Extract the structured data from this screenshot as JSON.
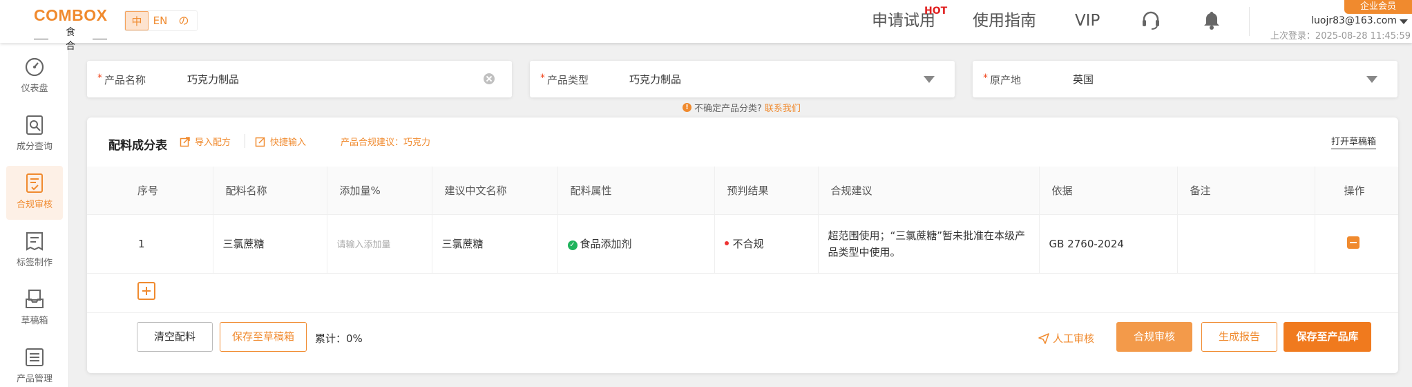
{
  "header": {
    "logo_main": "COMBOX",
    "logo_sub": "食合",
    "languages": [
      "中",
      "EN",
      "の"
    ],
    "active_language": "中",
    "nav": {
      "trial": "申请试用",
      "hot": "HOT",
      "guide": "使用指南",
      "vip": "VIP"
    },
    "vip_badge": "企业会员",
    "user_email": "luojr83@163.com",
    "last_login": "上次登录：2025-08-28 11:45:59"
  },
  "sidebar": {
    "items": [
      {
        "label": "仪表盘",
        "icon": "dashboard-icon"
      },
      {
        "label": "成分查询",
        "icon": "ingredient-search-icon"
      },
      {
        "label": "合规审核",
        "icon": "compliance-check-icon",
        "active": true
      },
      {
        "label": "标签制作",
        "icon": "label-make-icon"
      },
      {
        "label": "草稿箱",
        "icon": "drafts-icon"
      },
      {
        "label": "产品管理",
        "icon": "product-manage-icon"
      }
    ]
  },
  "form": {
    "product_name": {
      "label": "产品名称",
      "value": "巧克力制品"
    },
    "product_type": {
      "label": "产品类型",
      "value": "巧克力制品"
    },
    "origin": {
      "label": "原产地",
      "value": "英国"
    },
    "hint_text": "不确定产品分类?",
    "hint_link": "联系我们"
  },
  "card": {
    "title": "配料成分表",
    "import_recipe": "导入配方",
    "quick_input": "快捷输入",
    "suggestion": "产品合规建议：巧克力",
    "open_drafts": "打开草稿箱",
    "columns": [
      "序号",
      "配料名称",
      "添加量%",
      "建议中文名称",
      "配料属性",
      "预判结果",
      "合规建议",
      "依据",
      "备注",
      "操作"
    ],
    "rows": [
      {
        "index": "1",
        "name": "三氯蔗糖",
        "amount_placeholder": "请输入添加量",
        "cn_name": "三氯蔗糖",
        "attribute": "食品添加剂",
        "result": "不合规",
        "advice": "超范围使用；“三氯蔗糖”暂未批准在本级产品类型中使用。",
        "basis": "GB 2760-2024",
        "remark": ""
      }
    ],
    "buttons": {
      "clear": "清空配料",
      "save_draft": "保存至草稿箱",
      "total": "累计：0%",
      "manual_review": "人工审核",
      "compliance_review": "合规审核",
      "generate_report": "生成报告",
      "save_product": "保存至产品库"
    }
  },
  "colors": {
    "accent": "#f08a2e",
    "success": "#1fb35c",
    "danger": "#e33333"
  }
}
